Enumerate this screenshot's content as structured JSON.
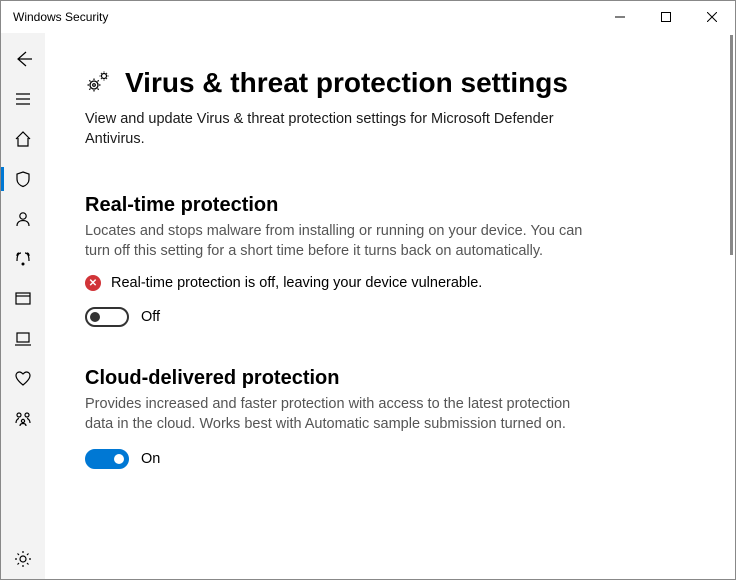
{
  "window": {
    "title": "Windows Security"
  },
  "page": {
    "title": "Virus & threat protection settings",
    "description": "View and update Virus & threat protection settings for Microsoft Defender Antivirus."
  },
  "sections": {
    "realtime": {
      "title": "Real-time protection",
      "description": "Locates and stops malware from installing or running on your device. You can turn off this setting for a short time before it turns back on automatically.",
      "warning": "Real-time protection is off, leaving your device vulnerable.",
      "toggle_state": "Off"
    },
    "cloud": {
      "title": "Cloud-delivered protection",
      "description": "Provides increased and faster protection with access to the latest protection data in the cloud. Works best with Automatic sample submission turned on.",
      "toggle_state": "On"
    }
  }
}
